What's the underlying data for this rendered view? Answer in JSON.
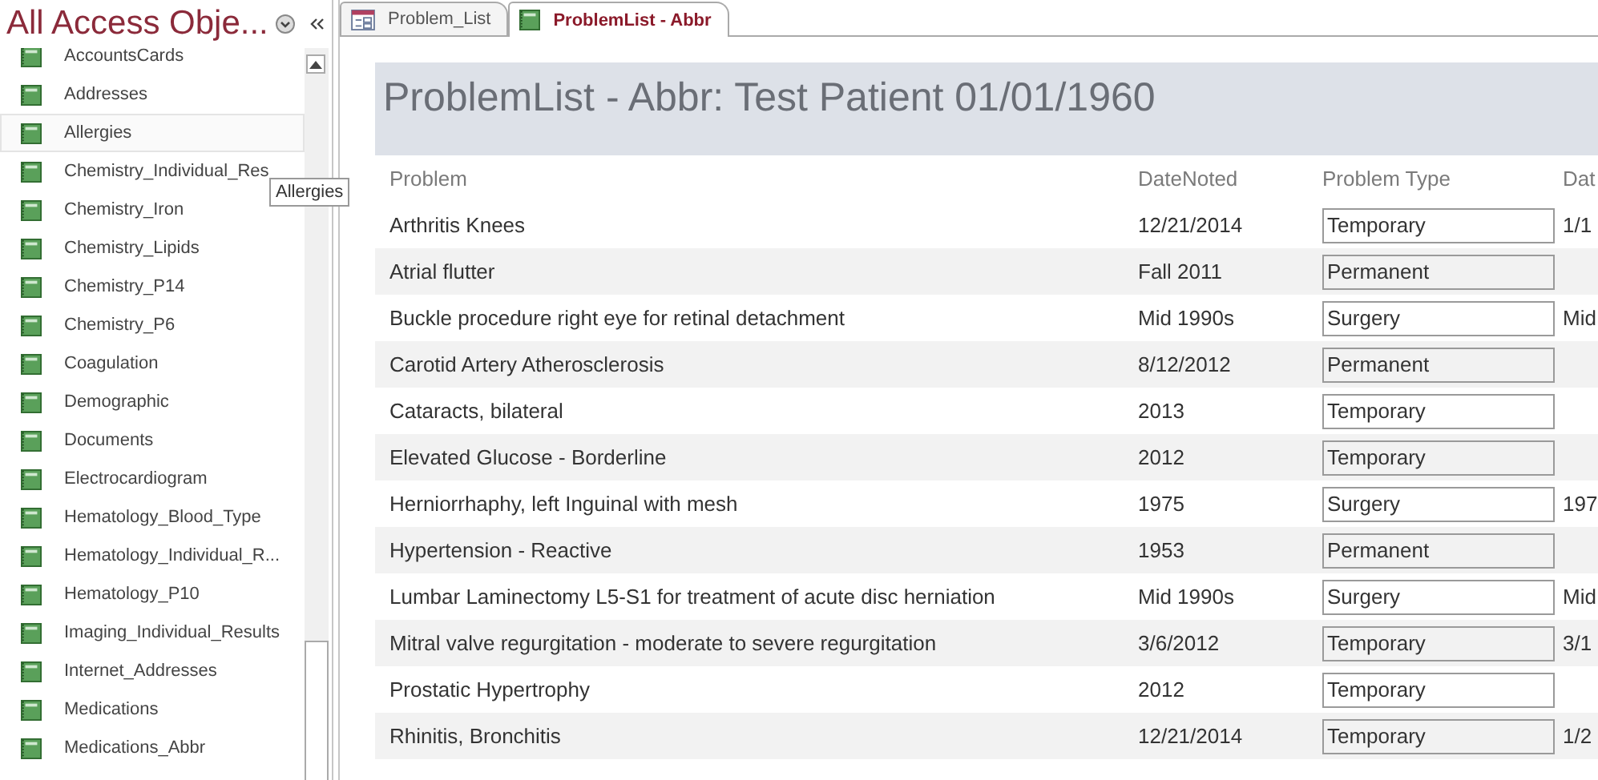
{
  "nav": {
    "title": "All Access Obje...",
    "items": [
      {
        "label": "AccountsCards",
        "selected": false
      },
      {
        "label": "Addresses",
        "selected": false
      },
      {
        "label": "Allergies",
        "selected": true
      },
      {
        "label": "Chemistry_Individual_Res",
        "selected": false
      },
      {
        "label": "Chemistry_Iron",
        "selected": false
      },
      {
        "label": "Chemistry_Lipids",
        "selected": false
      },
      {
        "label": "Chemistry_P14",
        "selected": false
      },
      {
        "label": "Chemistry_P6",
        "selected": false
      },
      {
        "label": "Coagulation",
        "selected": false
      },
      {
        "label": "Demographic",
        "selected": false
      },
      {
        "label": "Documents",
        "selected": false
      },
      {
        "label": "Electrocardiogram",
        "selected": false
      },
      {
        "label": "Hematology_Blood_Type",
        "selected": false
      },
      {
        "label": "Hematology_Individual_R...",
        "selected": false
      },
      {
        "label": "Hematology_P10",
        "selected": false
      },
      {
        "label": "Imaging_Individual_Results",
        "selected": false
      },
      {
        "label": "Internet_Addresses",
        "selected": false
      },
      {
        "label": "Medications",
        "selected": false
      },
      {
        "label": "Medications_Abbr",
        "selected": false
      }
    ],
    "tooltip": "Allergies"
  },
  "tabs": [
    {
      "label": "Problem_List",
      "kind": "form",
      "selected": false
    },
    {
      "label": "ProblemList - Abbr",
      "kind": "table",
      "selected": true
    }
  ],
  "form": {
    "title": "ProblemList - Abbr: Test Patient 01/01/1960",
    "columns": [
      "Problem",
      "DateNoted",
      "Problem Type",
      "Dat"
    ],
    "rows": [
      {
        "problem": "Arthritis Knees",
        "date": "12/21/2014",
        "type": "Temporary",
        "column_4": "1/1"
      },
      {
        "problem": "Atrial flutter",
        "date": "Fall 2011",
        "type": "Permanent",
        "column_4": ""
      },
      {
        "problem": "Buckle procedure right eye for retinal detachment",
        "date": "Mid 1990s",
        "type": "Surgery",
        "column_4": "Mid"
      },
      {
        "problem": "Carotid Artery Atherosclerosis",
        "date": "8/12/2012",
        "type": "Permanent",
        "column_4": ""
      },
      {
        "problem": "Cataracts, bilateral",
        "date": "2013",
        "type": "Temporary",
        "column_4": ""
      },
      {
        "problem": "Elevated Glucose - Borderline",
        "date": "2012",
        "type": "Temporary",
        "column_4": ""
      },
      {
        "problem": "Herniorrhaphy, left Inguinal with mesh",
        "date": "1975",
        "type": "Surgery",
        "column_4": "197"
      },
      {
        "problem": "Hypertension - Reactive",
        "date": "1953",
        "type": "Permanent",
        "column_4": ""
      },
      {
        "problem": "Lumbar Laminectomy L5-S1 for treatment of acute disc herniation",
        "date": "Mid 1990s",
        "type": "Surgery",
        "column_4": "Mid"
      },
      {
        "problem": "Mitral valve regurgitation - moderate to severe regurgitation",
        "date": "3/6/2012",
        "type": "Temporary",
        "column_4": "3/1"
      },
      {
        "problem": "Prostatic Hypertrophy",
        "date": "2012",
        "type": "Temporary",
        "column_4": ""
      },
      {
        "problem": "Rhinitis, Bronchitis",
        "date": "12/21/2014",
        "type": "Temporary",
        "column_4": "1/2"
      }
    ]
  }
}
